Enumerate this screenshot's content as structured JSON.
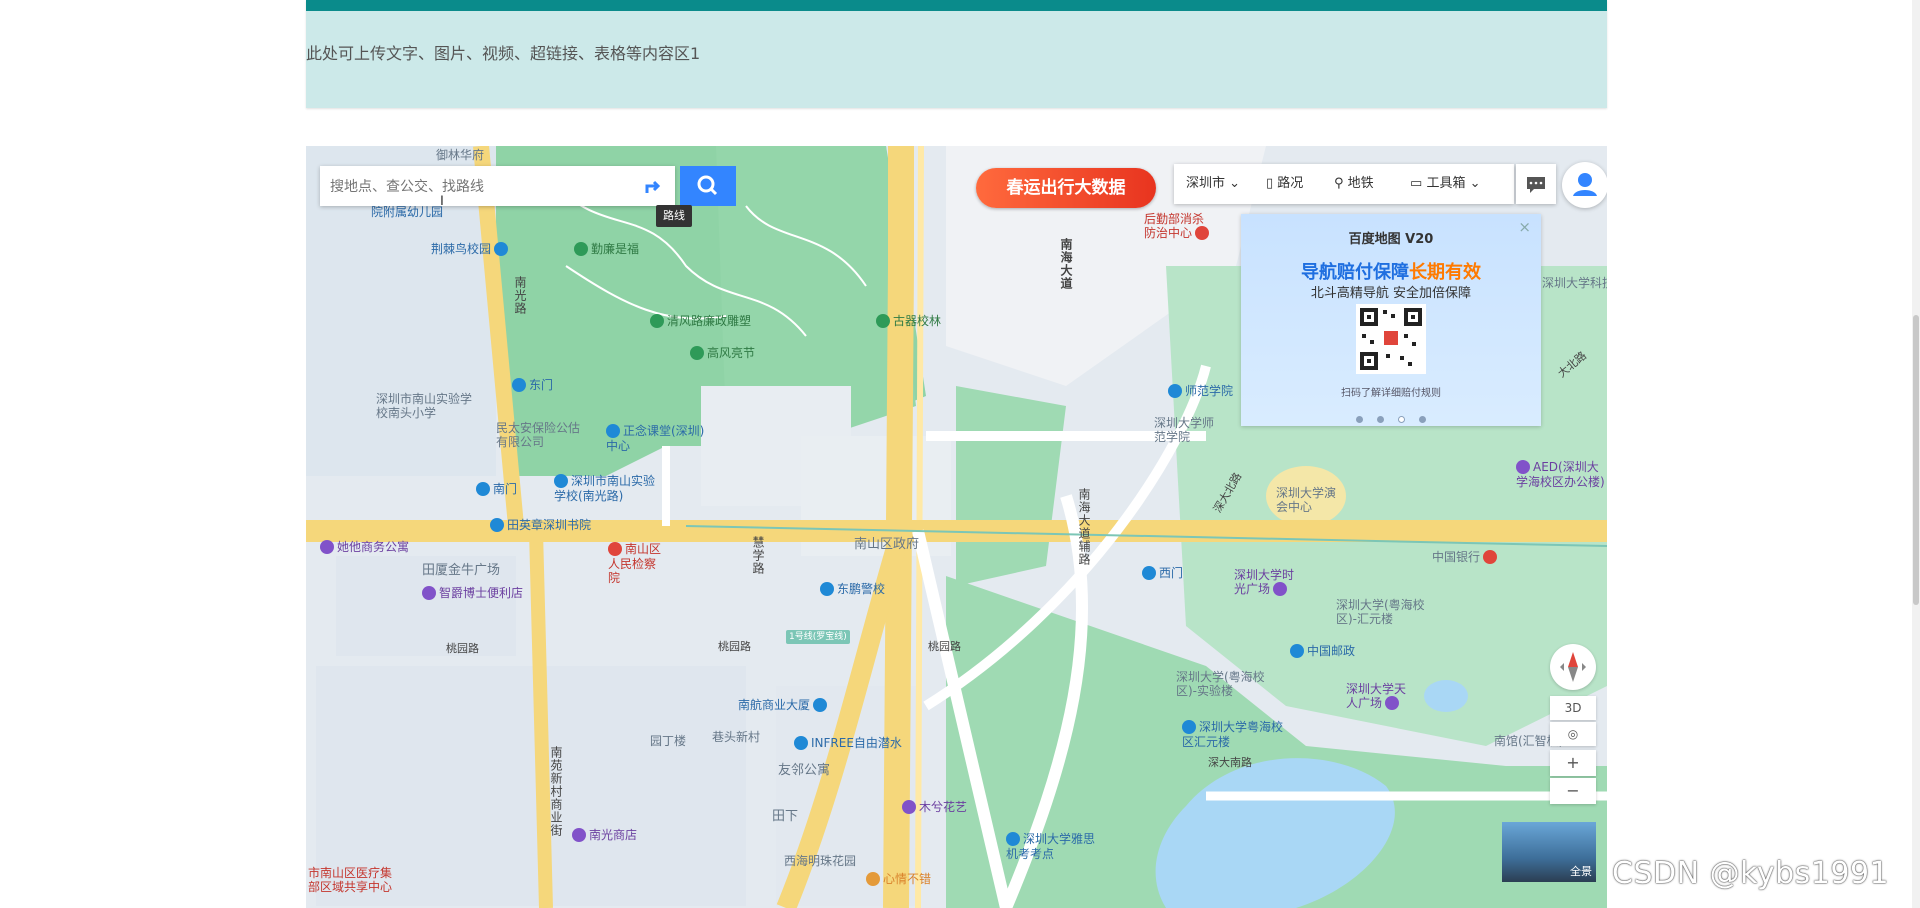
{
  "banner": {
    "text": "此处可上传文字、图片、视频、超链接、表格等内容区1"
  },
  "search": {
    "placeholder": "搜地点、查公交、找路线",
    "route_tooltip": "路线"
  },
  "ad_banner": {
    "text": "春运出行大数据"
  },
  "toolbar": {
    "city": "深圳市",
    "traffic": "路况",
    "subway": "地铁",
    "tools": "工具箱"
  },
  "promo": {
    "close": "×",
    "brand": "百度地图 V20",
    "title_a": "导航赔付保障",
    "title_b": "长期有效",
    "subtitle": "北斗高精导航 安全加倍保障",
    "note": "扫码了解详细赔付规则"
  },
  "map_controls": {
    "three_d": "3D",
    "zoom_in": "+",
    "zoom_out": "−",
    "panorama": "全景"
  },
  "watermark": "CSDN @kybs1991",
  "map_labels": [
    {
      "t": "御林华府",
      "c": "gray"
    },
    {
      "t": "深圳市南山区教科院附属幼儿园",
      "c": "blue"
    },
    {
      "t": "荆棘鸟校园",
      "c": "blue"
    },
    {
      "t": "勤廉是福",
      "c": "green"
    },
    {
      "t": "清风路廉政雕塑",
      "c": "green"
    },
    {
      "t": "古器校林",
      "c": "green"
    },
    {
      "t": "高风亮节",
      "c": "green"
    },
    {
      "t": "南光路",
      "c": "road"
    },
    {
      "t": "东门",
      "c": "blue"
    },
    {
      "t": "深圳市南山实验学校南头小学",
      "c": "gray"
    },
    {
      "t": "民太安保险公估有限公司",
      "c": "gray"
    },
    {
      "t": "正念课堂(深圳)中心",
      "c": "blue"
    },
    {
      "t": "深圳市南山实验学校(南光路)",
      "c": "blue"
    },
    {
      "t": "南门",
      "c": "blue"
    },
    {
      "t": "田英章深圳书院",
      "c": "blue"
    },
    {
      "t": "她他商务公寓",
      "c": "purple"
    },
    {
      "t": "田厦金牛广场",
      "c": "gray"
    },
    {
      "t": "智爵博士便利店",
      "c": "purple"
    },
    {
      "t": "南山区人民检察院",
      "c": "red"
    },
    {
      "t": "南山区政府",
      "c": "gray"
    },
    {
      "t": "东鹏警校",
      "c": "blue"
    },
    {
      "t": "慧学路",
      "c": "road"
    },
    {
      "t": "桃园路",
      "c": "road"
    },
    {
      "t": "1号线(罗宝线)",
      "c": "road"
    },
    {
      "t": "南海大道",
      "c": "road"
    },
    {
      "t": "南海大道辅路",
      "c": "road"
    },
    {
      "t": "后勤部消杀防治中心",
      "c": "red"
    },
    {
      "t": "师范学院",
      "c": "blue"
    },
    {
      "t": "深圳大学师范学院",
      "c": "gray"
    },
    {
      "t": "深圳大学演会中心",
      "c": "gray"
    },
    {
      "t": "西门",
      "c": "blue"
    },
    {
      "t": "深圳大学时光广场",
      "c": "purple"
    },
    {
      "t": "深大北路",
      "c": "road"
    },
    {
      "t": "中国邮政",
      "c": "blue"
    },
    {
      "t": "中国银行",
      "c": "red"
    },
    {
      "t": "深圳大学(粤海校区)-汇元楼",
      "c": "gray"
    },
    {
      "t": "深圳大学(粤海校区)-实验楼",
      "c": "gray"
    },
    {
      "t": "深圳大学天人广场",
      "c": "purple"
    },
    {
      "t": "深圳大学粤海校区汇元楼",
      "c": "blue"
    },
    {
      "t": "深大南路",
      "c": "road"
    },
    {
      "t": "南航商业大厦",
      "c": "blue"
    },
    {
      "t": "园丁楼",
      "c": "gray"
    },
    {
      "t": "巷头新村",
      "c": "gray"
    },
    {
      "t": "INFREE自由潜水",
      "c": "blue"
    },
    {
      "t": "友邻公寓",
      "c": "gray"
    },
    {
      "t": "木兮花艺",
      "c": "purple"
    },
    {
      "t": "田下",
      "c": "gray"
    },
    {
      "t": "深圳大学雅思机考考点",
      "c": "blue"
    },
    {
      "t": "南光商店",
      "c": "purple"
    },
    {
      "t": "西海明珠花园",
      "c": "gray"
    },
    {
      "t": "心情不错",
      "c": "orange"
    },
    {
      "t": "南苑新村商业街",
      "c": "road"
    },
    {
      "t": "市南山区医疗集部区域共享中心",
      "c": "red"
    },
    {
      "t": "AED(深圳大学海校区办公楼)",
      "c": "purple"
    },
    {
      "t": "深圳大学科技",
      "c": "gray"
    },
    {
      "t": "大北路",
      "c": "road"
    },
    {
      "t": "南馆(汇智楼)",
      "c": "gray"
    }
  ]
}
